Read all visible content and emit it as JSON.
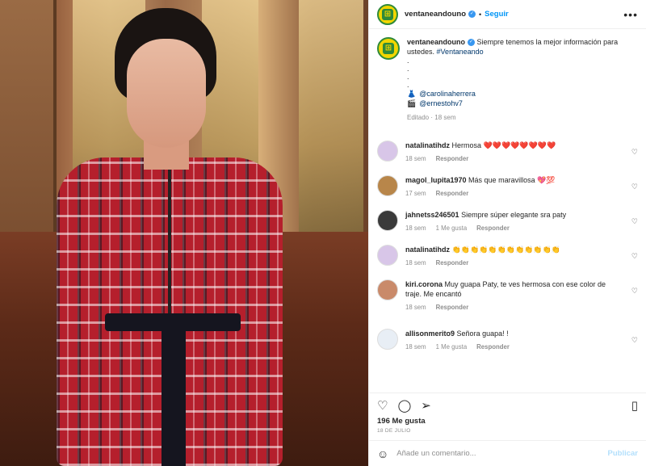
{
  "header": {
    "username": "ventaneandouno",
    "separator": "•",
    "follow_label": "Seguir",
    "more_icon": "more-horizontal-icon",
    "avatar_glyph": "⊞"
  },
  "caption": {
    "username": "ventaneandouno",
    "text": "Siempre tenemos la mejor información para ustedes.",
    "hashtag": "#Ventaneando",
    "dots": [
      ".",
      ".",
      ".",
      "."
    ],
    "credit_1_emoji": "👗",
    "credit_1": "@carolinaherrera",
    "credit_2_emoji": "🎬",
    "credit_2": "@ernestohv7",
    "meta": "Editado · 18 sem"
  },
  "comments": [
    {
      "username": "natalinatihdz",
      "text": "Hermosa ❤️❤️❤️❤️❤️❤️❤️❤️",
      "time": "18 sem",
      "likes": "",
      "reply": "Responder"
    },
    {
      "username": "magol_lupita1970",
      "text": "Más que maravillosa 💖💯",
      "time": "17 sem",
      "likes": "",
      "reply": "Responder"
    },
    {
      "username": "jahnetss246501",
      "text": "Siempre súper elegante sra paty",
      "time": "18 sem",
      "likes": "1 Me gusta",
      "reply": "Responder"
    },
    {
      "username": "natalinatihdz",
      "text": "👏👏👏👏👏👏👏👏👏👏👏👏",
      "time": "18 sem",
      "likes": "",
      "reply": "Responder"
    },
    {
      "username": "kiri.corona",
      "text": "Muy guapa Paty, te ves hermosa con ese color de traje. Me encantó",
      "time": "18 sem",
      "likes": "",
      "reply": "Responder"
    },
    {
      "username": "allisonmerito9",
      "text": "Señora guapa! !",
      "time": "18 sem",
      "likes": "1 Me gusta",
      "reply": "Responder"
    }
  ],
  "actions": {
    "like_icon": "heart-icon",
    "comment_icon": "comment-icon",
    "share_icon": "share-icon",
    "save_icon": "bookmark-icon",
    "likes": "196 Me gusta",
    "date": "18 DE JULIO"
  },
  "add_comment": {
    "placeholder": "Añade un comentario...",
    "post_label": "Publicar"
  },
  "colors": {
    "accent": "#0095f6",
    "brand_green": "#2f8a3a",
    "brand_yellow": "#f2d600"
  }
}
